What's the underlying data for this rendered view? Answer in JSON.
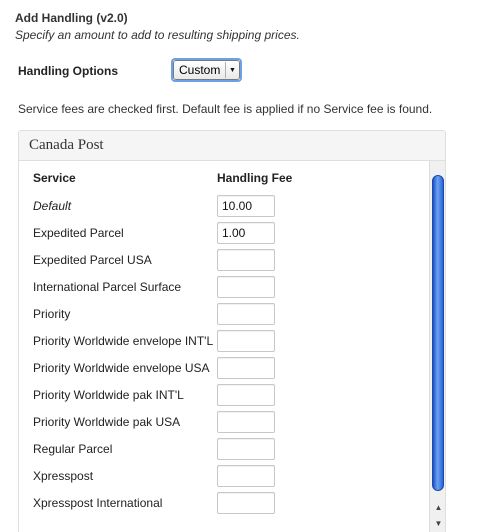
{
  "section": {
    "title": "Add Handling (v2.0)",
    "description": "Specify an amount to add to resulting shipping prices."
  },
  "handling_options": {
    "label": "Handling Options",
    "selected": "Custom"
  },
  "note": "Service fees are checked first. Default fee is applied if no Service fee is found.",
  "panel": {
    "title": "Canada Post",
    "columns": {
      "service": "Service",
      "fee": "Handling Fee"
    },
    "rows": [
      {
        "service": "Default",
        "fee": "10.00",
        "italic": true
      },
      {
        "service": "Expedited Parcel",
        "fee": "1.00"
      },
      {
        "service": "Expedited Parcel USA",
        "fee": ""
      },
      {
        "service": "International Parcel Surface",
        "fee": ""
      },
      {
        "service": "Priority",
        "fee": ""
      },
      {
        "service": "Priority Worldwide envelope INT'L",
        "fee": ""
      },
      {
        "service": "Priority Worldwide envelope USA",
        "fee": ""
      },
      {
        "service": "Priority Worldwide pak INT'L",
        "fee": ""
      },
      {
        "service": "Priority Worldwide pak USA",
        "fee": ""
      },
      {
        "service": "Regular Parcel",
        "fee": ""
      },
      {
        "service": "Xpresspost",
        "fee": ""
      },
      {
        "service": "Xpresspost International",
        "fee": ""
      }
    ]
  },
  "icons": {
    "select_arrow": "chevron-down-icon",
    "scroll_up": "arrow-up-icon",
    "scroll_down": "arrow-down-icon"
  },
  "colors": {
    "scroll_thumb": "#2a62d6",
    "focus_ring": "#6da1e6"
  }
}
